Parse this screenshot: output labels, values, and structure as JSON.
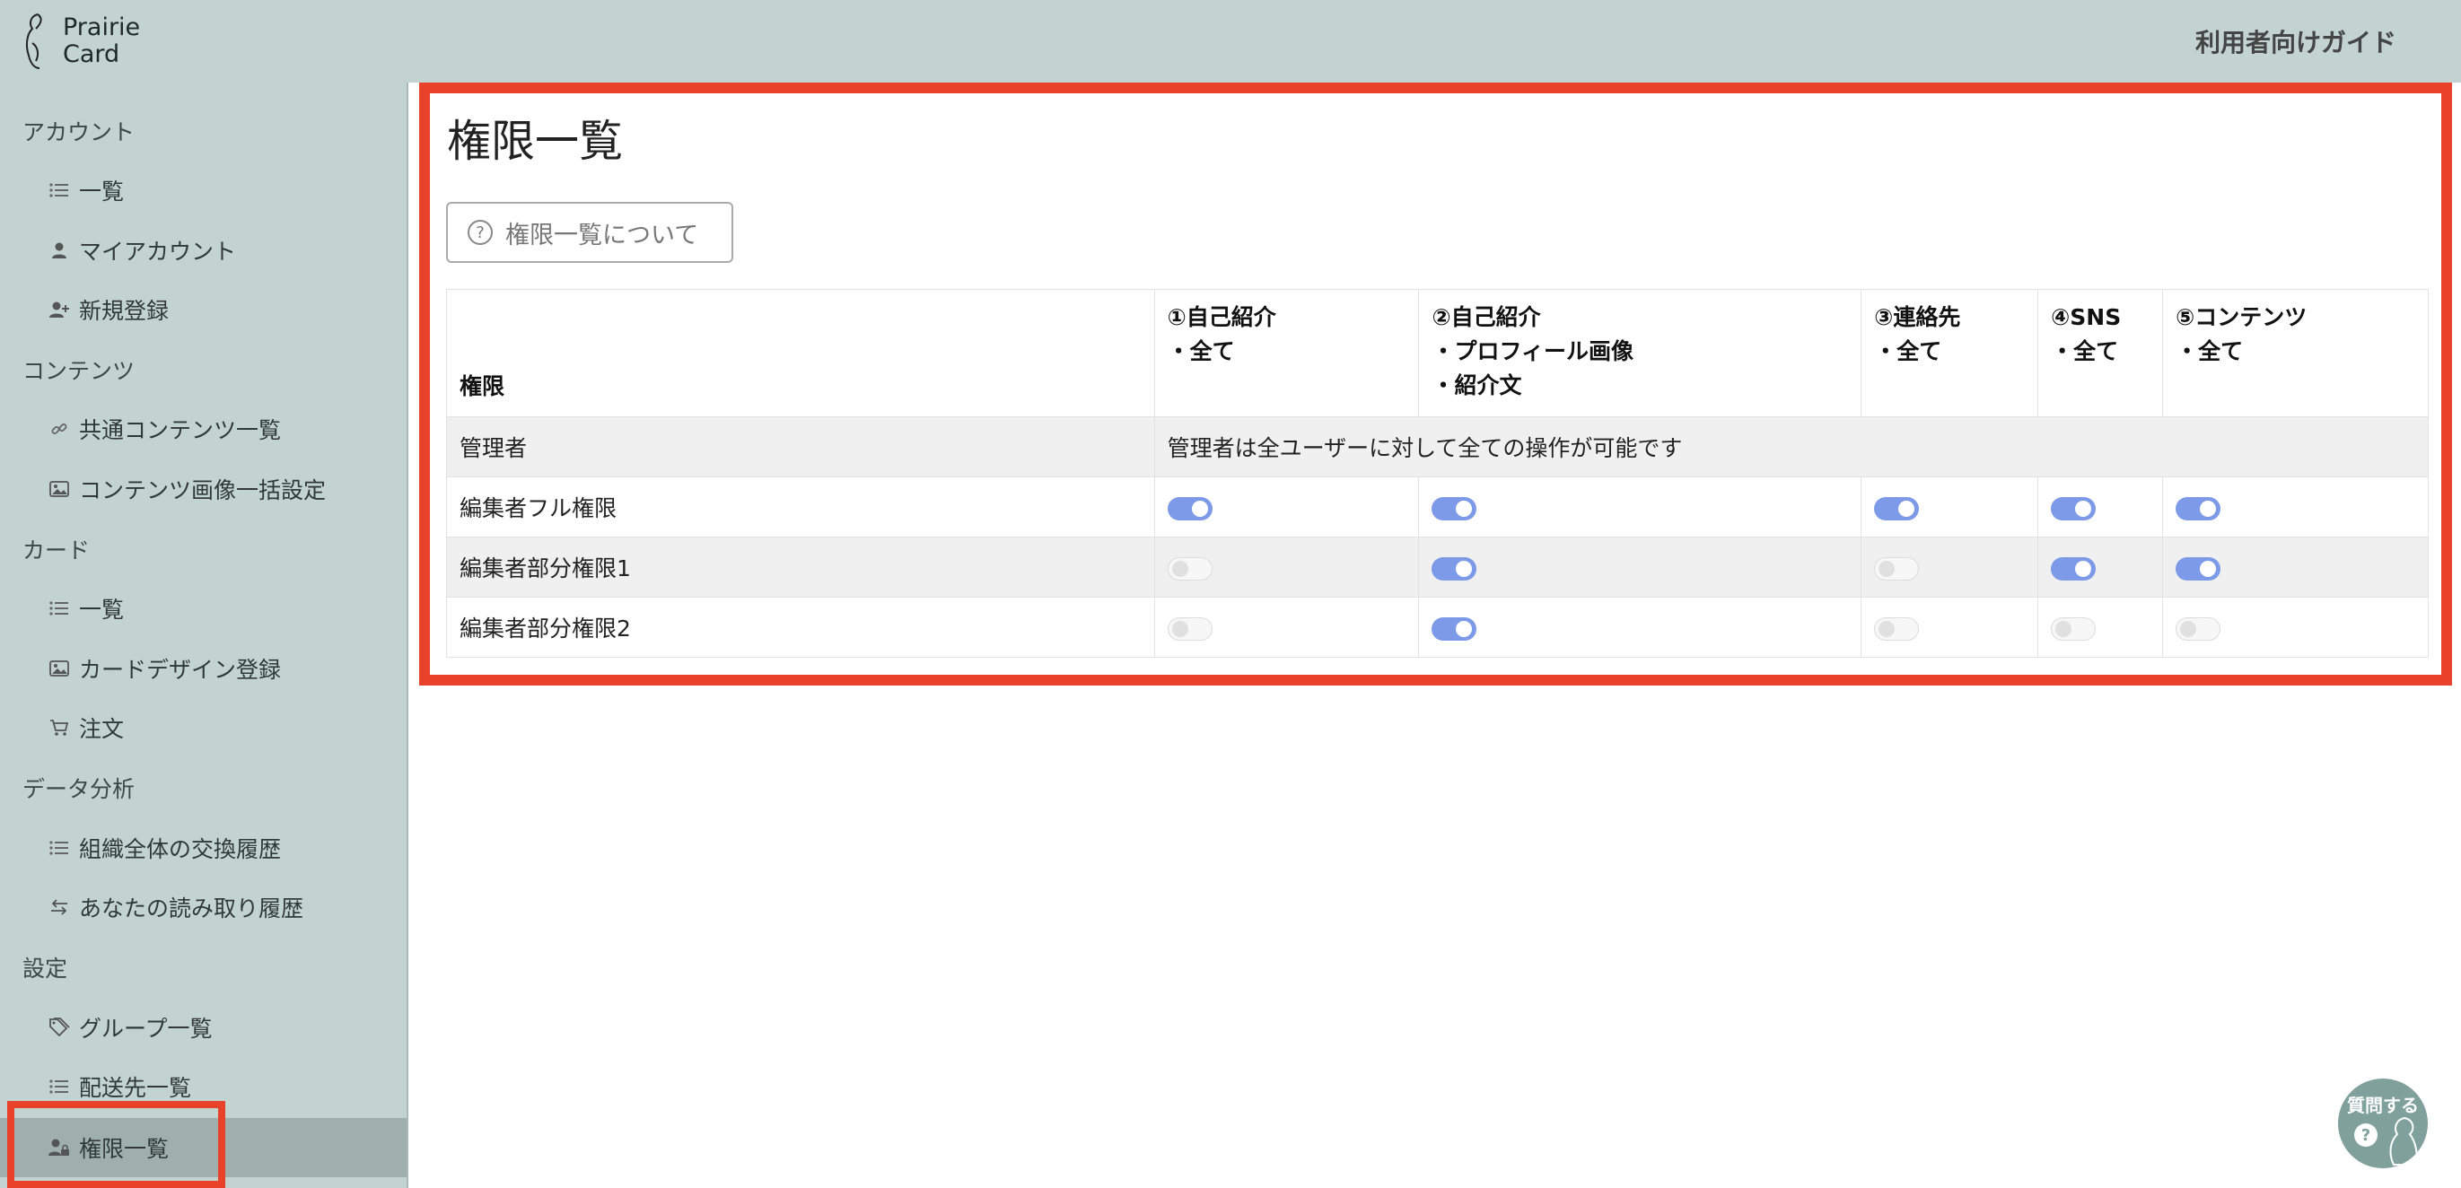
{
  "header": {
    "logo_line1": "Prairie",
    "logo_line2": "Card",
    "guide_link": "利用者向けガイド"
  },
  "sidebar": {
    "sections": {
      "account": "アカウント",
      "contents": "コンテンツ",
      "card": "カード",
      "analytics": "データ分析",
      "settings": "設定"
    },
    "items": {
      "account_list": "一覧",
      "my_account": "マイアカウント",
      "new_registration": "新規登録",
      "shared_contents": "共通コンテンツ一覧",
      "contents_image_bulk": "コンテンツ画像一括設定",
      "card_list": "一覧",
      "card_design": "カードデザイン登録",
      "order": "注文",
      "org_exchange_history": "組織全体の交換履歴",
      "your_read_history": "あなたの読み取り履歴",
      "group_list": "グループ一覧",
      "shipping_list": "配送先一覧",
      "permission_list": "権限一覧"
    },
    "icons": {
      "list": "list-icon",
      "person": "person-icon",
      "person_add": "person-add-icon",
      "link": "link-icon",
      "image": "image-icon",
      "cart": "cart-icon",
      "exchange": "exchange-icon",
      "tag": "tag-icon",
      "person_lock": "person-lock-icon"
    }
  },
  "main": {
    "title": "権限一覧",
    "about_button": "権限一覧について",
    "table": {
      "headers": {
        "role": "権限",
        "col1_line1": "①自己紹介",
        "col1_line2": "・全て",
        "col2_line1": "②自己紹介",
        "col2_line2": "・プロフィール画像",
        "col2_line3": "・紹介文",
        "col3_line1": "③連絡先",
        "col3_line2": "・全て",
        "col4_line1": "④SNS",
        "col4_line2": "・全て",
        "col5_line1": "⑤コンテンツ",
        "col5_line2": "・全て"
      },
      "admin": {
        "role": "管理者",
        "note": "管理者は全ユーザーに対して全ての操作が可能です"
      },
      "rows": [
        {
          "role": "編集者フル権限",
          "toggles": [
            true,
            true,
            true,
            true,
            true
          ]
        },
        {
          "role": "編集者部分権限1",
          "toggles": [
            false,
            true,
            false,
            true,
            true
          ]
        },
        {
          "role": "編集者部分権限2",
          "toggles": [
            false,
            true,
            false,
            false,
            false
          ]
        }
      ]
    }
  },
  "help": {
    "label": "質問する",
    "mark": "?"
  },
  "colors": {
    "header_bg": "#c3d3cf",
    "highlight": "#e8432a",
    "toggle_on": "#7d9ae8",
    "active_nav": "#9fafab"
  }
}
